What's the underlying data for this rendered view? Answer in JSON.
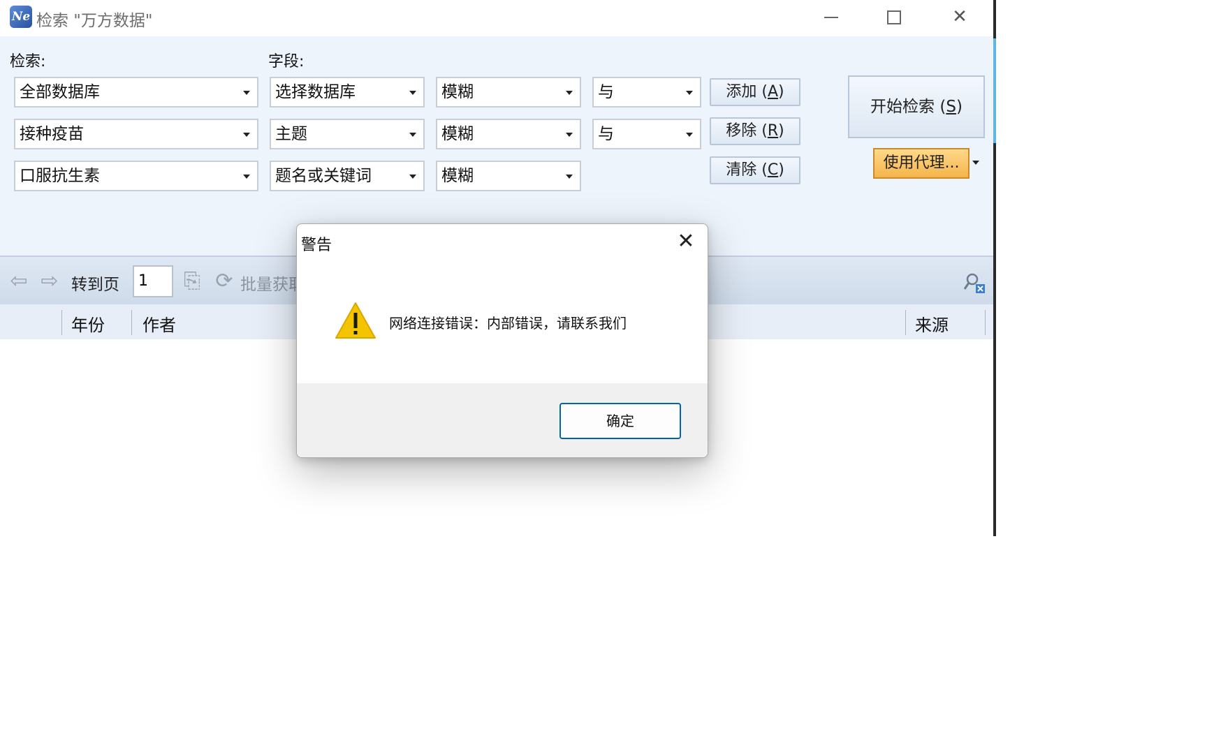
{
  "window": {
    "icon_text": "Ne",
    "title": "检索 \"万方数据\""
  },
  "search": {
    "label": "检索:",
    "field_label": "字段:",
    "rows": [
      {
        "term": "全部数据库",
        "field": "选择数据库",
        "match": "模糊",
        "logic": "与"
      },
      {
        "term": "接种疫苗",
        "field": "主题",
        "match": "模糊",
        "logic": "与"
      },
      {
        "term": "口服抗生素",
        "field": "题名或关键词",
        "match": "模糊"
      }
    ],
    "buttons": {
      "add": "添加",
      "add_key": "A",
      "remove": "移除",
      "remove_key": "R",
      "clear": "清除",
      "clear_key": "C"
    },
    "start": "开始检索",
    "start_key": "S",
    "proxy": "使用代理..."
  },
  "toolbar": {
    "goto_label": "转到页",
    "page_value": "1",
    "batch_label": "批量获取"
  },
  "columns": [
    "年份",
    "作者",
    "来源"
  ],
  "dialog": {
    "title": "警告",
    "message": "网络连接错误：内部错误，请联系我们",
    "ok": "确定"
  },
  "colors": {
    "accent": "#0063b1",
    "warning": "#f5c400",
    "proxy": "#f5b44a"
  }
}
